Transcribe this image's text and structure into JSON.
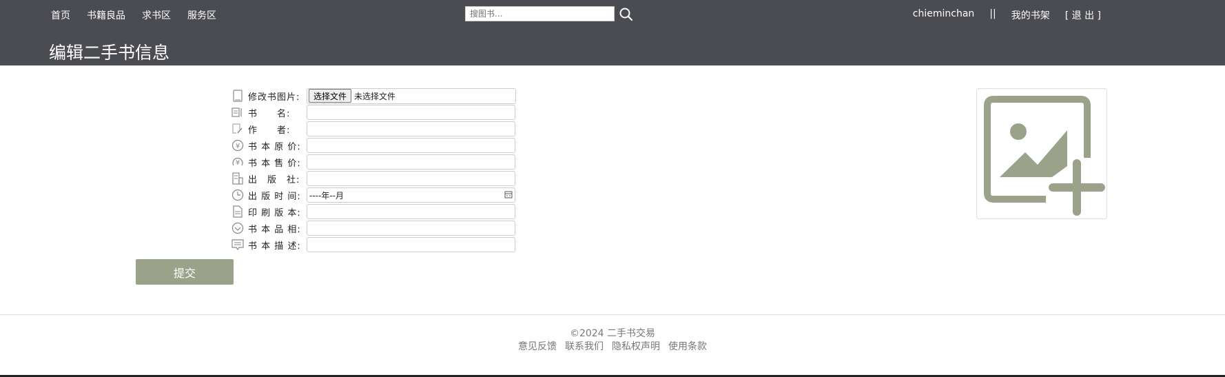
{
  "nav": {
    "home": "首页",
    "books": "书籍良品",
    "request": "求书区",
    "service": "服务区"
  },
  "search": {
    "placeholder": "搜图书..."
  },
  "user": {
    "name": "chieminchan",
    "separator": "||",
    "shelf": "我的书架",
    "logout": "[ 退 出 ]"
  },
  "page_title": "编辑二手书信息",
  "form": {
    "image_label": "修改书图片:",
    "file_button": "选择文件",
    "file_status": "未选择文件",
    "fields": [
      {
        "label": "书　　名:",
        "icon": "book-name-icon"
      },
      {
        "label": "作　　者:",
        "icon": "author-icon"
      },
      {
        "label": "书 本 原 价:",
        "icon": "price-icon"
      },
      {
        "label": "书 本 售 价:",
        "icon": "sale-price-icon"
      },
      {
        "label": "出　版　社:",
        "icon": "publisher-icon"
      },
      {
        "label": "出 版 时 间:",
        "icon": "clock-icon",
        "value": "----年--月"
      },
      {
        "label": "印 刷 版 本:",
        "icon": "edition-icon"
      },
      {
        "label": "书 本 品 相:",
        "icon": "condition-icon"
      },
      {
        "label": "书 本 描 述:",
        "icon": "description-icon"
      }
    ],
    "submit": "提交"
  },
  "footer": {
    "copyright": "©2024 二手书交易",
    "links": [
      "意见反馈",
      "联系我们",
      "隐私权声明",
      "使用条款"
    ]
  },
  "colors": {
    "header_bg": "#4b4c51",
    "accent": "#9aa38a"
  }
}
